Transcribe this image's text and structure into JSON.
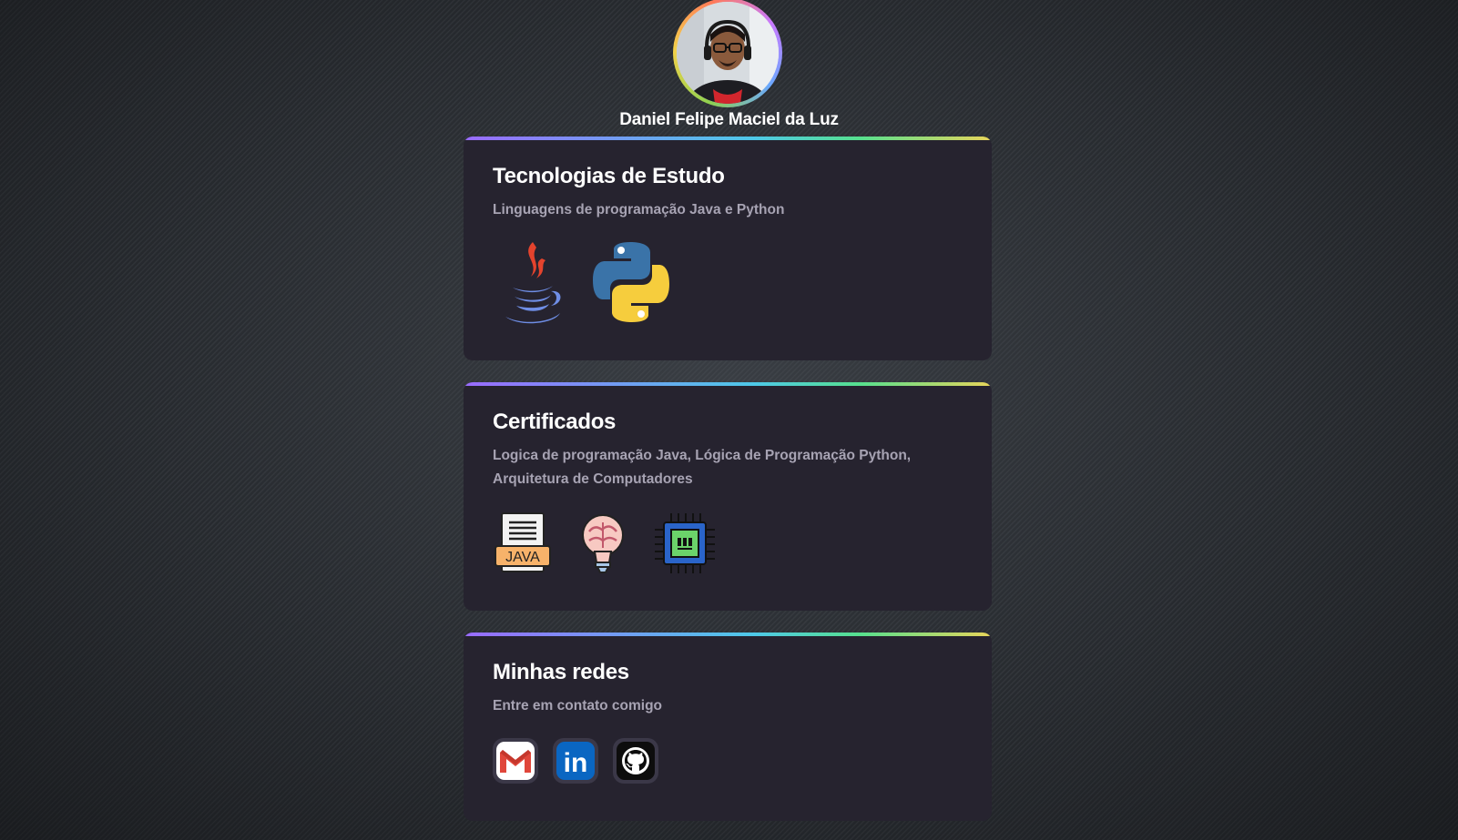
{
  "profile": {
    "name": "Daniel Felipe Maciel da Luz",
    "avatar_icon": "profile-photo"
  },
  "cards": {
    "tech": {
      "title": "Tecnologias de Estudo",
      "subtitle": "Linguagens de programação Java e Python",
      "icons": [
        "java-icon",
        "python-icon"
      ]
    },
    "cert": {
      "title": "Certificados",
      "subtitle": "Logica de programação Java, Lógica de Programação Python, Arquitetura de Computadores",
      "icons": [
        "java-file-icon",
        "brain-bulb-icon",
        "cpu-chip-icon"
      ],
      "java_label": "JAVA"
    },
    "social": {
      "title": "Minhas redes",
      "subtitle": "Entre em contato comigo",
      "links": [
        "gmail-icon",
        "linkedin-icon",
        "github-icon"
      ],
      "linkedin_label": "in"
    }
  },
  "colors": {
    "card_bg": "#26232f",
    "subtitle": "#a7a3b3",
    "accent_gradient": [
      "#9a6bff",
      "#4ec9e8",
      "#56e08e",
      "#e8d55a"
    ]
  }
}
